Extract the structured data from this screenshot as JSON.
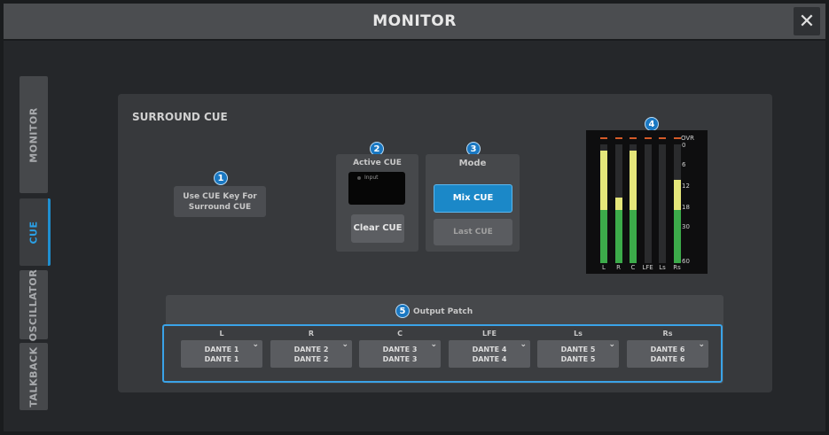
{
  "window": {
    "title": "MONITOR",
    "close_icon": "close-icon"
  },
  "tabs": [
    {
      "label": "MONITOR",
      "active": false
    },
    {
      "label": "CUE",
      "active": true
    },
    {
      "label": "OSCILLATOR",
      "active": false
    },
    {
      "label": "TALKBACK",
      "active": false
    }
  ],
  "panel": {
    "title": "SURROUND CUE"
  },
  "badges": [
    "1",
    "2",
    "3",
    "4",
    "5"
  ],
  "use_cue_key": {
    "label_line1": "Use CUE Key For",
    "label_line2": "Surround CUE"
  },
  "active_cue": {
    "label": "Active CUE",
    "indicator": "Input",
    "clear_button": "Clear CUE"
  },
  "mode": {
    "label": "Mode",
    "options": [
      "Mix CUE",
      "Last CUE"
    ],
    "selected": "Mix CUE"
  },
  "meter": {
    "overload_label": "OVR",
    "scale": [
      "0",
      "6",
      "12",
      "18",
      "30",
      "60"
    ],
    "channels": [
      {
        "label": "L",
        "level": 0.95,
        "color": "#e4e67a"
      },
      {
        "label": "R",
        "level": 0.55,
        "color": "#e4e67a"
      },
      {
        "label": "C",
        "level": 0.95,
        "color": "#e4e67a"
      },
      {
        "label": "LFE",
        "level": 0.0,
        "color": "#e4e67a"
      },
      {
        "label": "Ls",
        "level": 0.0,
        "color": "#e4e67a"
      },
      {
        "label": "Rs",
        "level": 0.7,
        "color": "#e4e67a"
      }
    ],
    "green_color": "#3cab4a"
  },
  "output_patch": {
    "label": "Output Patch",
    "channels": [
      {
        "label": "L",
        "line1": "DANTE 1",
        "line2": "DANTE 1"
      },
      {
        "label": "R",
        "line1": "DANTE 2",
        "line2": "DANTE 2"
      },
      {
        "label": "C",
        "line1": "DANTE 3",
        "line2": "DANTE 3"
      },
      {
        "label": "LFE",
        "line1": "DANTE 4",
        "line2": "DANTE 4"
      },
      {
        "label": "Ls",
        "line1": "DANTE 5",
        "line2": "DANTE 5"
      },
      {
        "label": "Rs",
        "line1": "DANTE 6",
        "line2": "DANTE 6"
      }
    ]
  },
  "colors": {
    "accent": "#1f8fd0",
    "mix_cue_active": "#1b88c8"
  }
}
